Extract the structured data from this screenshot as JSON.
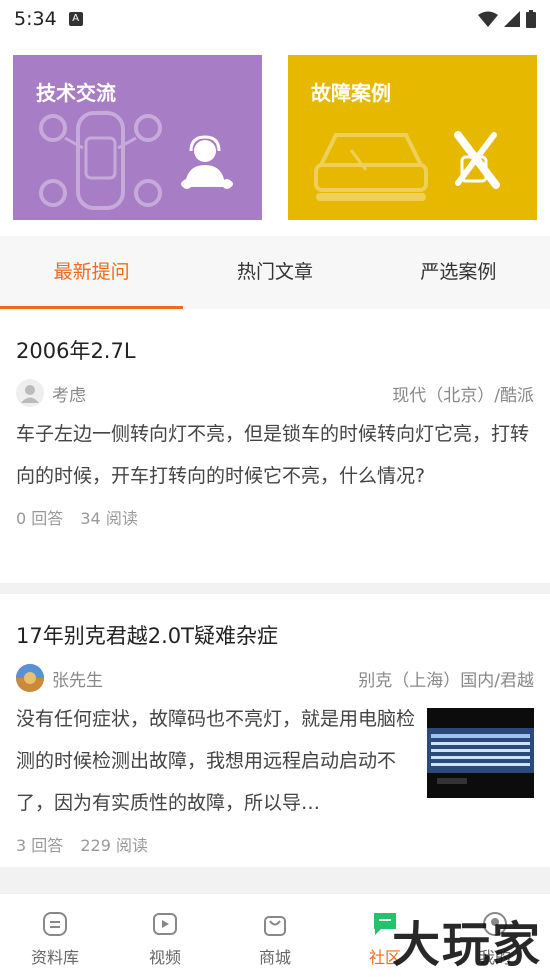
{
  "status_bar": {
    "time": "5:34",
    "notification_icon": "A"
  },
  "banners": [
    {
      "title": "技术交流"
    },
    {
      "title": "故障案例"
    }
  ],
  "tabs": [
    {
      "label": "最新提问",
      "active": true
    },
    {
      "label": "热门文章",
      "active": false
    },
    {
      "label": "严选案例",
      "active": false
    }
  ],
  "posts": [
    {
      "title": "2006年2.7L",
      "author": "考虑",
      "car": "现代（北京）/酷派",
      "content": "车子左边一侧转向灯不亮，但是锁车的时候转向灯它亮，打转向的时候，开车打转向的时候它不亮，什么情况?",
      "answers": "0 回答",
      "reads": "34 阅读"
    },
    {
      "title": "17年别克君越2.0T疑难杂症",
      "author": "张先生",
      "car": "别克（上海）国内/君越",
      "content": "没有任何症状，故障码也不亮灯，就是用电脑检测的时候检测出故障，我想用远程启动启动不了，因为有实质性的故障，所以导…",
      "answers": "3 回答",
      "reads": "229 阅读"
    }
  ],
  "bottom_nav": [
    {
      "label": "资料库",
      "icon": "database-icon"
    },
    {
      "label": "视频",
      "icon": "video-icon"
    },
    {
      "label": "商城",
      "icon": "shop-bag-icon"
    },
    {
      "label": "社区",
      "icon": "community-icon",
      "active": true
    },
    {
      "label": "我的",
      "icon": "profile-icon"
    }
  ],
  "watermark": "大玩家",
  "colors": {
    "accent": "#f26b1d",
    "tech_banner": "#a77dc6",
    "fault_banner": "#e6b800"
  }
}
